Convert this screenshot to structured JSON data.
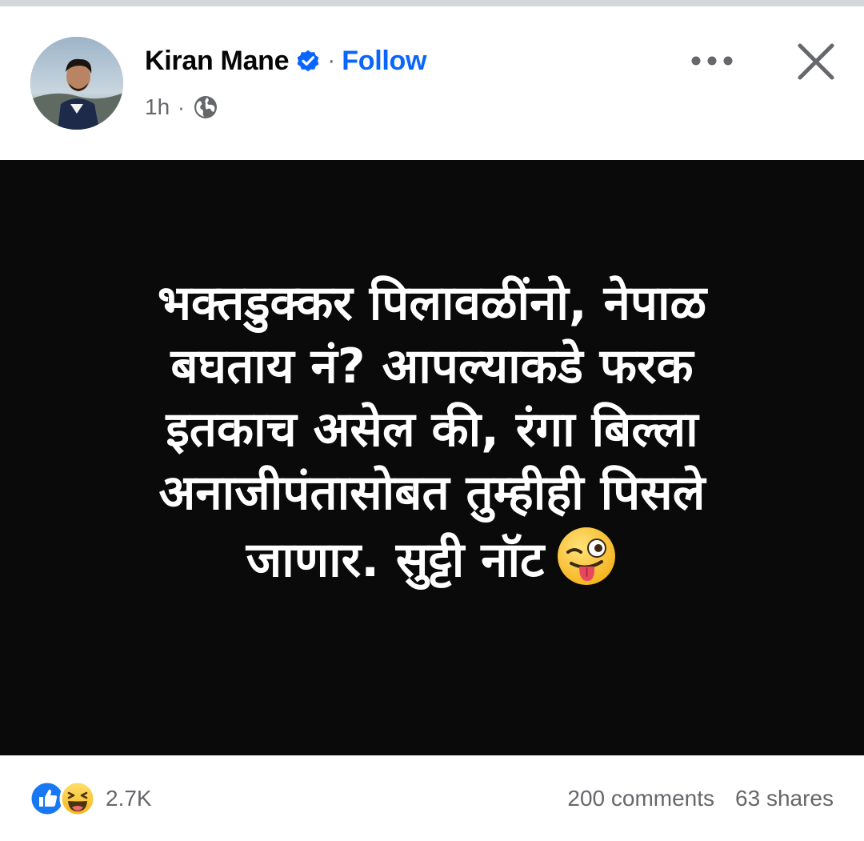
{
  "post": {
    "author": {
      "name": "Kiran Mane",
      "verified": true,
      "separator": "·",
      "follow_label": "Follow"
    },
    "meta": {
      "time": "1h",
      "separator": "·",
      "audience_icon": "globe-icon"
    },
    "actions": {
      "more_icon": "more-options-icon",
      "close_icon": "close-icon"
    },
    "content": {
      "background_color": "#0a0a0a",
      "text_color": "#ffffff",
      "lines": [
        "भक्तडुक्कर पिलावळींनो, नेपाळ",
        "बघताय नं? आपल्याकडे फरक",
        "इतकाच असेल की, रंगा बिल्ला",
        "अनाजीपंतासोबत तुम्हीही पिसले",
        "जाणार. सुट्टी नॉट"
      ],
      "trailing_emoji": "winking-face-with-tongue"
    },
    "engagement": {
      "reaction_icons": [
        "like-icon",
        "haha-icon"
      ],
      "reactions_count": "2.7K",
      "comments_label": "200 comments",
      "shares_label": "63 shares"
    }
  },
  "colors": {
    "link_blue": "#0866ff",
    "verified_blue": "#0866ff",
    "secondary_text": "#65676b",
    "primary_text": "#050505"
  }
}
